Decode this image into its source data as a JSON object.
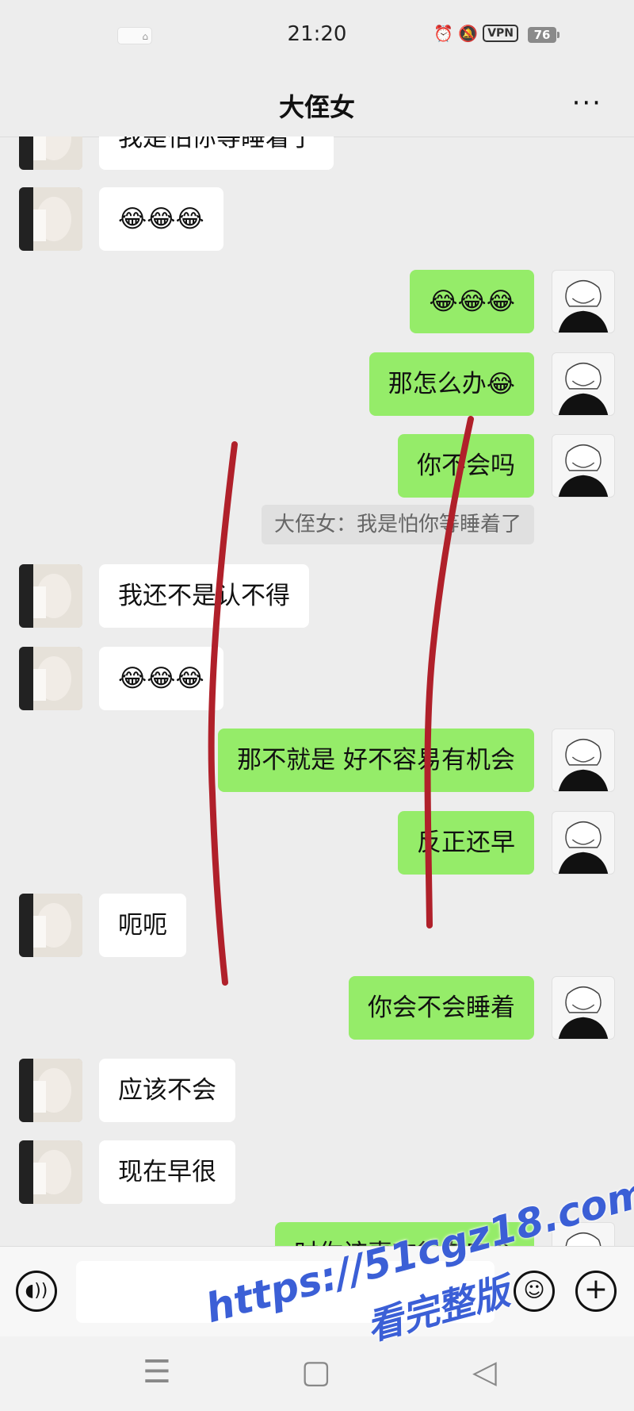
{
  "status_bar": {
    "time": "21:20",
    "vpn": "VPN",
    "battery": "76",
    "icons": [
      "alarm-icon",
      "mute-bell-icon",
      "vpn-badge",
      "battery-icon"
    ]
  },
  "nav": {
    "title": "大侄女",
    "more": "···"
  },
  "messages": [
    {
      "side": "her",
      "text": "我是怕你等睡着了"
    },
    {
      "side": "her",
      "text": "😂😂😂"
    },
    {
      "side": "me",
      "text": "😂😂😂"
    },
    {
      "side": "me",
      "text": "那怎么办😂"
    },
    {
      "side": "me",
      "text": "你不会吗"
    },
    {
      "side": "quote",
      "text": "大侄女：我是怕你等睡着了"
    },
    {
      "side": "her",
      "text": "我还不是认不得"
    },
    {
      "side": "her",
      "text": "😂😂😂"
    },
    {
      "side": "me",
      "text": "那不就是 好不容易有机会"
    },
    {
      "side": "me",
      "text": "反正还早"
    },
    {
      "side": "her",
      "text": "呃呃"
    },
    {
      "side": "me",
      "text": "你会不会睡着"
    },
    {
      "side": "her",
      "text": "应该不会"
    },
    {
      "side": "her",
      "text": "现在早很"
    },
    {
      "side": "me",
      "text": "时你该喜欢很有安全"
    }
  ],
  "input_bar": {
    "placeholder": "",
    "voice_icon": "voice-icon",
    "emoji_icon": "emoji-icon",
    "plus_icon": "plus-icon"
  },
  "system_nav": {
    "menu": "☰",
    "home": "▢",
    "back": "◁"
  },
  "watermark": {
    "line1": "https://51cgz18.com",
    "line2": "看完整版"
  },
  "colors": {
    "background": "#ededed",
    "my_bubble": "#95ec69",
    "her_bubble": "#ffffff",
    "scribble": "#b0202a"
  }
}
